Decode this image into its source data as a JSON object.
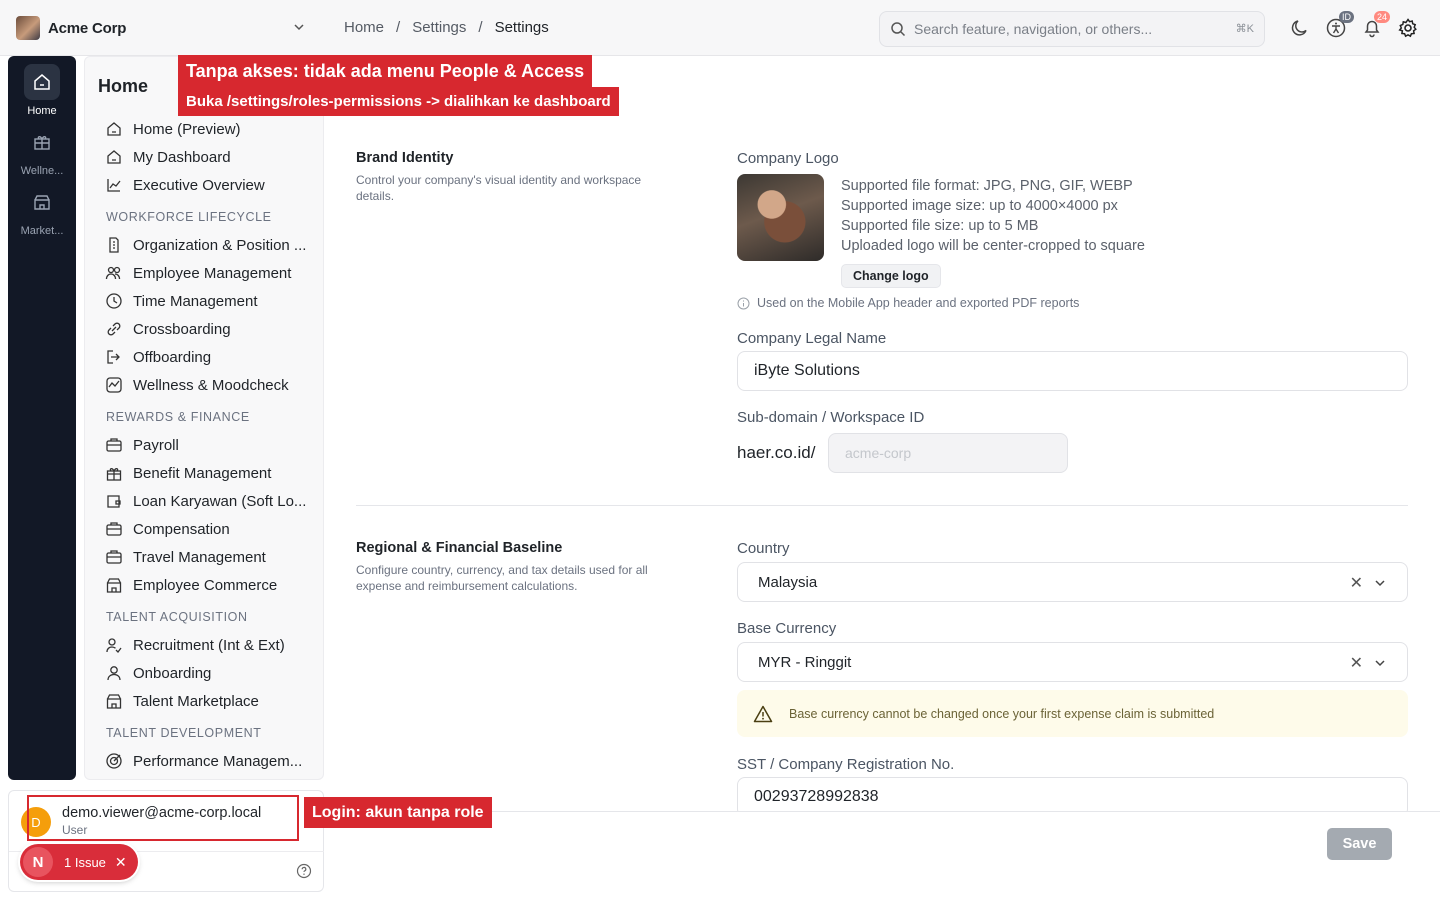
{
  "org": {
    "name": "Acme Corp"
  },
  "breadcrumb": [
    "Home",
    "/",
    "Settings",
    "/",
    "Settings"
  ],
  "search": {
    "placeholder": "Search feature, navigation, or others...",
    "shortcut": "⌘K"
  },
  "topbar": {
    "id_badge": "ID",
    "notification_count": "24"
  },
  "rail": [
    {
      "label": "Home",
      "icon": "home-icon",
      "active": true
    },
    {
      "label": "Wellne...",
      "icon": "gift-icon"
    },
    {
      "label": "Market...",
      "icon": "store-icon"
    }
  ],
  "sidebar": {
    "title": "Home",
    "items": [
      {
        "label": "Home (Preview)",
        "icon": "home-icon"
      },
      {
        "label": "My Dashboard",
        "icon": "home-icon"
      },
      {
        "label": "Executive Overview",
        "icon": "chart-icon"
      },
      {
        "section": "WORKFORCE LIFECYCLE"
      },
      {
        "label": "Organization & Position ...",
        "icon": "building-icon"
      },
      {
        "label": "Employee Management",
        "icon": "users-icon"
      },
      {
        "label": "Time Management",
        "icon": "clock-icon"
      },
      {
        "label": "Crossboarding",
        "icon": "link-icon"
      },
      {
        "label": "Offboarding",
        "icon": "logout-icon"
      },
      {
        "label": "Wellness & Moodcheck",
        "icon": "activity-icon"
      },
      {
        "section": "REWARDS & FINANCE"
      },
      {
        "label": "Payroll",
        "icon": "briefcase-icon"
      },
      {
        "label": "Benefit Management",
        "icon": "gift-icon"
      },
      {
        "label": "Loan Karyawan (Soft Lo...",
        "icon": "wallet-icon"
      },
      {
        "label": "Compensation",
        "icon": "briefcase-icon"
      },
      {
        "label": "Travel Management",
        "icon": "briefcase-icon"
      },
      {
        "label": "Employee Commerce",
        "icon": "store-icon"
      },
      {
        "section": "TALENT ACQUISITION"
      },
      {
        "label": "Recruitment (Int & Ext)",
        "icon": "user-check-icon"
      },
      {
        "label": "Onboarding",
        "icon": "user-icon"
      },
      {
        "label": "Talent Marketplace",
        "icon": "store-icon"
      },
      {
        "section": "TALENT DEVELOPMENT"
      },
      {
        "label": "Performance Managem...",
        "icon": "target-icon"
      }
    ]
  },
  "user": {
    "initial": "D",
    "email": "demo.viewer@acme-corp.local",
    "role": "User"
  },
  "issue": {
    "initial": "N",
    "label": "1 Issue",
    "close": "✕"
  },
  "annotations": {
    "title": "Tanpa akses: tidak ada menu People & Access",
    "subtitle": "Buka /settings/roles-permissions -> dialihkan ke dashboard",
    "login": "Login: akun tanpa role"
  },
  "brand": {
    "title": "Brand Identity",
    "desc": "Control your company's visual identity and workspace details.",
    "logo_label": "Company Logo",
    "logo_info": [
      "Supported file format: JPG, PNG, GIF, WEBP",
      "Supported image size: up to 4000×4000 px",
      "Supported file size: up to 5 MB",
      "Uploaded logo will be center-cropped to square"
    ],
    "change_logo": "Change logo",
    "note": "Used on the Mobile App header and exported PDF reports",
    "legal_name_label": "Company Legal Name",
    "legal_name": "iByte Solutions",
    "subdomain_label": "Sub-domain / Workspace ID",
    "subdomain_prefix": "haer.co.id/",
    "subdomain_value": "acme-corp"
  },
  "regional": {
    "title": "Regional & Financial Baseline",
    "desc": "Configure country, currency, and tax details used for all expense and reimbursement calculations.",
    "country_label": "Country",
    "country": "Malaysia",
    "currency_label": "Base Currency",
    "currency": "MYR - Ringgit",
    "warning": "Base currency cannot be changed once your first expense claim is submitted",
    "sst_label": "SST / Company Registration No.",
    "sst": "00293728992838"
  },
  "footer": {
    "save": "Save"
  }
}
